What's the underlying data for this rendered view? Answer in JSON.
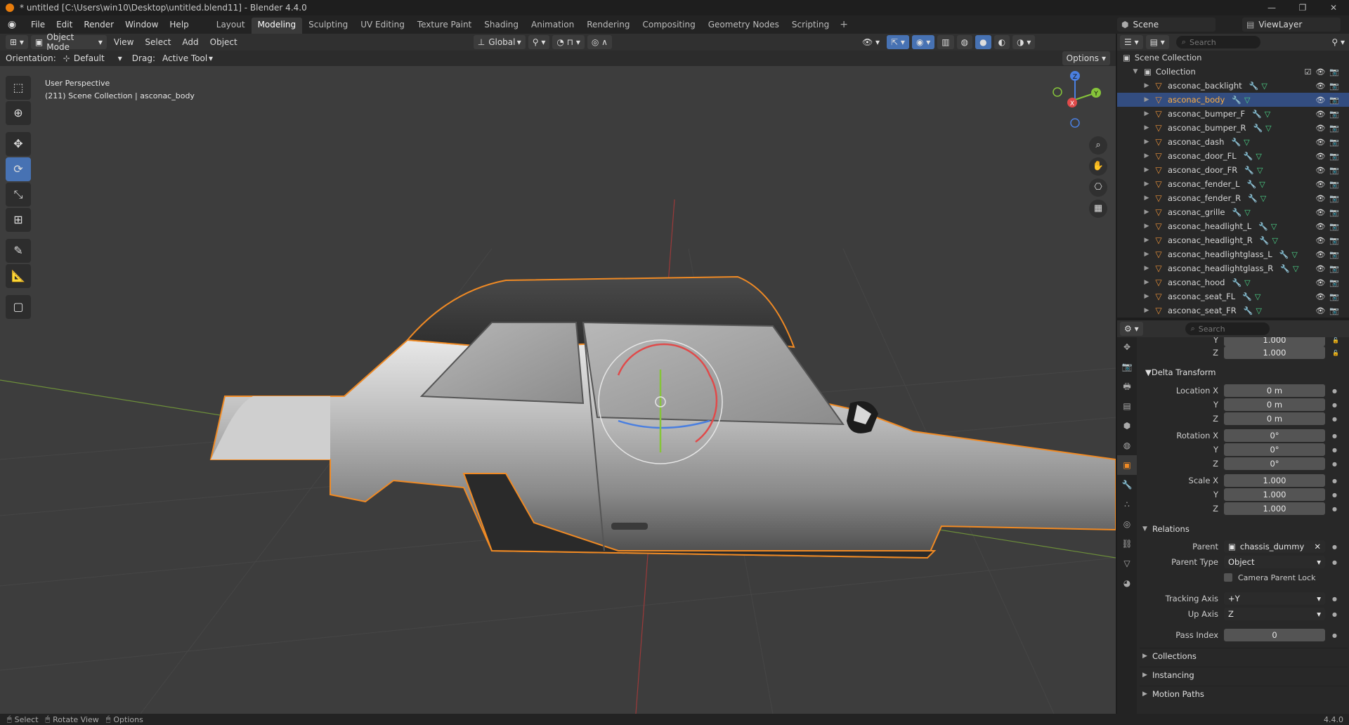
{
  "window": {
    "title": "* untitled [C:\\Users\\win10\\Desktop\\untitled.blend11] - Blender 4.4.0",
    "controls": [
      "—",
      "❐",
      "✕"
    ]
  },
  "menu": [
    "File",
    "Edit",
    "Render",
    "Window",
    "Help"
  ],
  "workspaces": [
    {
      "label": "Layout"
    },
    {
      "label": "Modeling",
      "active": true
    },
    {
      "label": "Sculpting"
    },
    {
      "label": "UV Editing"
    },
    {
      "label": "Texture Paint"
    },
    {
      "label": "Shading"
    },
    {
      "label": "Animation"
    },
    {
      "label": "Rendering"
    },
    {
      "label": "Compositing"
    },
    {
      "label": "Geometry Nodes"
    },
    {
      "label": "Scripting"
    }
  ],
  "scene": {
    "name": "Scene",
    "view_layer": "ViewLayer"
  },
  "viewport_header": {
    "mode": "Object Mode",
    "menus": [
      "View",
      "Select",
      "Add",
      "Object"
    ],
    "transform_orientation": "Global"
  },
  "tool_settings": {
    "orientation_label": "Orientation:",
    "orientation_value": "Default",
    "drag_label": "Drag:",
    "drag_value": "Active Tool",
    "options_label": "Options"
  },
  "viewport": {
    "perspective": "User Perspective",
    "context": "(211) Scene Collection | asconac_body",
    "gizmo_axes": {
      "x": "X",
      "y": "Y",
      "z": "Z"
    }
  },
  "outliner": {
    "search_placeholder": "Search",
    "root": "Scene Collection",
    "collection": "Collection",
    "items": [
      {
        "name": "asconac_backlight"
      },
      {
        "name": "asconac_body",
        "selected": true
      },
      {
        "name": "asconac_bumper_F"
      },
      {
        "name": "asconac_bumper_R"
      },
      {
        "name": "asconac_dash"
      },
      {
        "name": "asconac_door_FL"
      },
      {
        "name": "asconac_door_FR"
      },
      {
        "name": "asconac_fender_L"
      },
      {
        "name": "asconac_fender_R"
      },
      {
        "name": "asconac_grille"
      },
      {
        "name": "asconac_headlight_L"
      },
      {
        "name": "asconac_headlight_R"
      },
      {
        "name": "asconac_headlightglass_L"
      },
      {
        "name": "asconac_headlightglass_R"
      },
      {
        "name": "asconac_hood"
      },
      {
        "name": "asconac_seat_FL"
      },
      {
        "name": "asconac_seat_FR"
      }
    ]
  },
  "properties": {
    "search_placeholder": "Search",
    "scale_top": {
      "y_label": "Y",
      "y_value": "1.000",
      "z_label": "Z",
      "z_value": "1.000"
    },
    "delta_transform": {
      "title": "Delta Transform",
      "location": {
        "label": "Location X",
        "x": "0 m",
        "y": "0 m",
        "z": "0 m"
      },
      "rotation": {
        "label": "Rotation X",
        "x": "0°",
        "y": "0°",
        "z": "0°"
      },
      "scale": {
        "label": "Scale X",
        "x": "1.000",
        "y": "1.000",
        "z": "1.000"
      },
      "y_label": "Y",
      "z_label": "Z"
    },
    "relations": {
      "title": "Relations",
      "parent_label": "Parent",
      "parent_value": "chassis_dummy",
      "parent_type_label": "Parent Type",
      "parent_type_value": "Object",
      "camera_parent_lock": "Camera Parent Lock",
      "tracking_axis_label": "Tracking Axis",
      "tracking_axis_value": "+Y",
      "up_axis_label": "Up Axis",
      "up_axis_value": "Z",
      "pass_index_label": "Pass Index",
      "pass_index_value": "0"
    },
    "collapsed_sections": [
      "Collections",
      "Instancing",
      "Motion Paths"
    ]
  },
  "statusbar": {
    "items": [
      "Select",
      "Rotate View",
      "Options"
    ],
    "version": "4.4.0"
  },
  "colors": {
    "accent": "#4772b3",
    "selection_outline": "#f08a24",
    "axis_x": "#e04a4a",
    "axis_y": "#86c43a",
    "axis_z": "#4a7fe0"
  }
}
